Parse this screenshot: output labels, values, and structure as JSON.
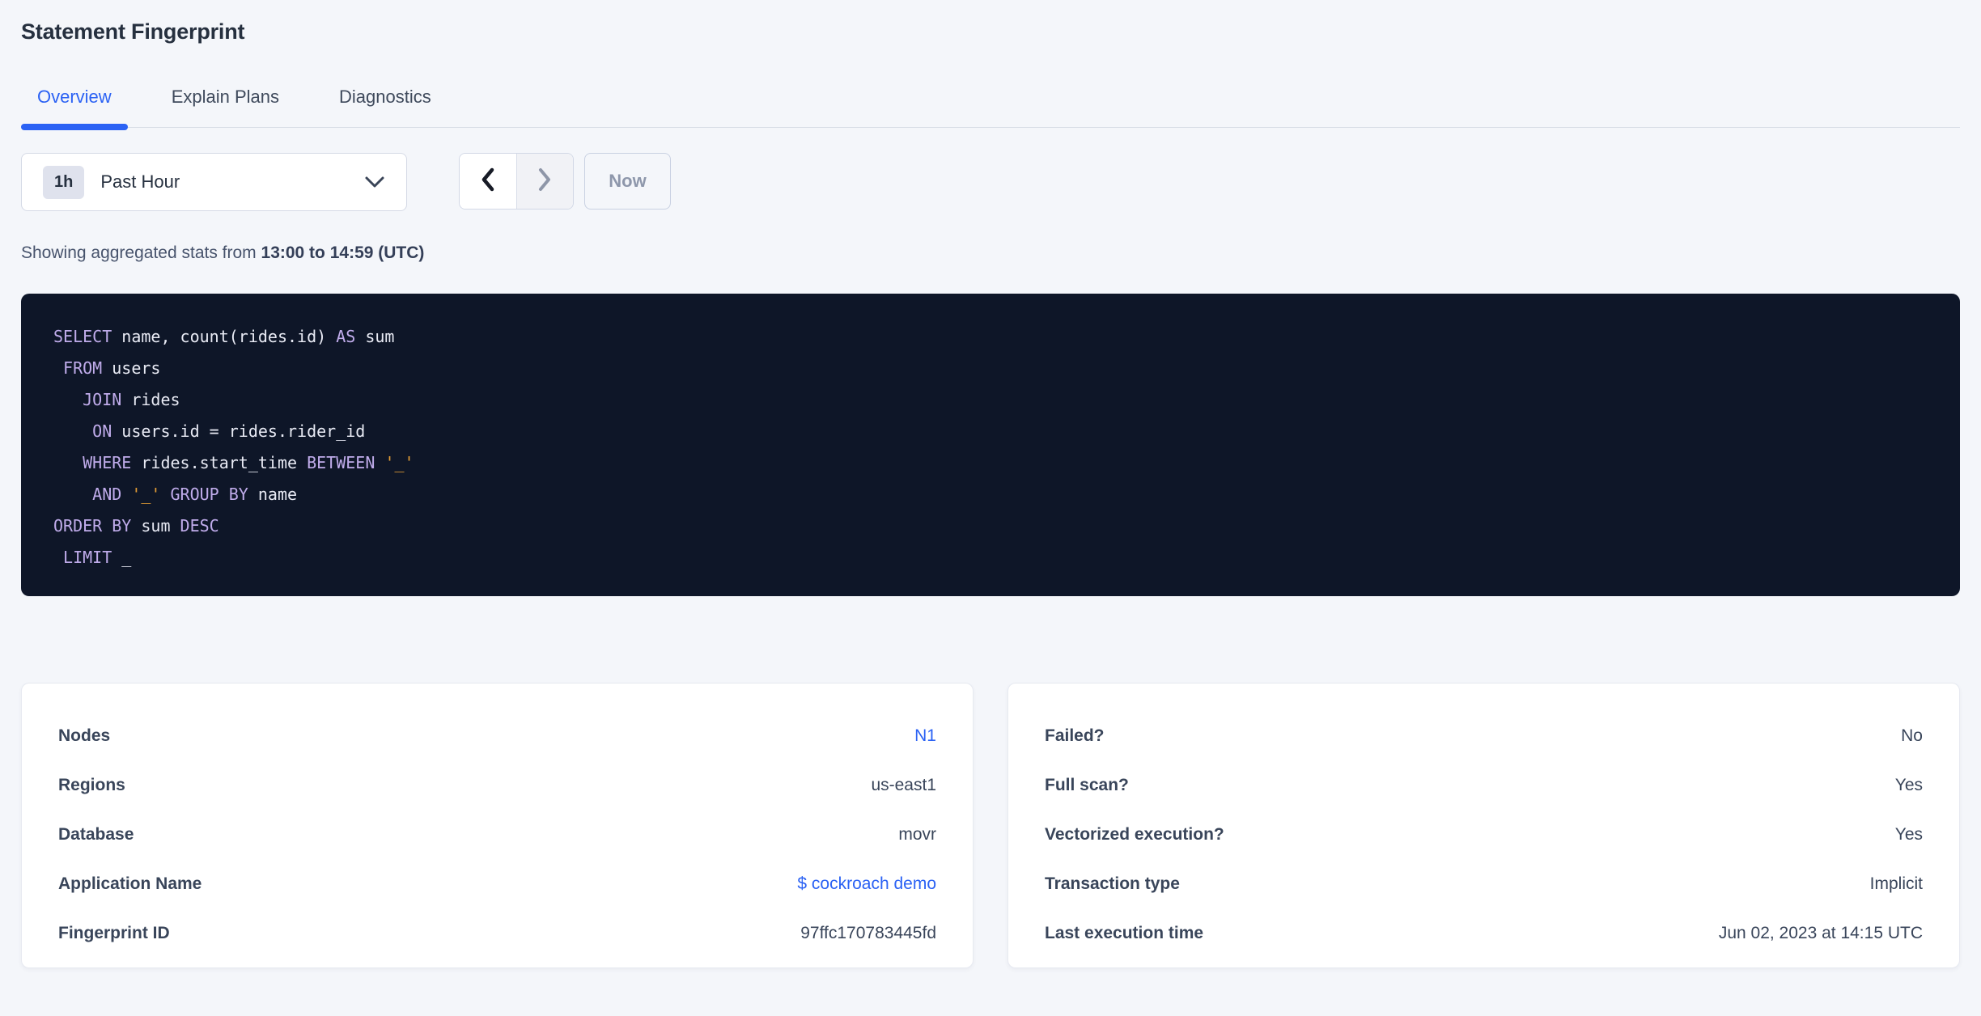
{
  "page": {
    "title": "Statement Fingerprint"
  },
  "tabs": [
    {
      "label": "Overview",
      "active": true
    },
    {
      "label": "Explain Plans",
      "active": false
    },
    {
      "label": "Diagnostics",
      "active": false
    }
  ],
  "time_picker": {
    "badge": "1h",
    "selected_label": "Past Hour",
    "now_label": "Now",
    "icons": {
      "open": "chevron-down-icon",
      "prev": "chevron-left-icon",
      "next": "chevron-right-icon"
    }
  },
  "stats_line": {
    "prefix": "Showing aggregated stats from ",
    "range_bold": "13:00 to 14:59 (UTC)"
  },
  "sql": {
    "lines": [
      [
        {
          "c": "kw",
          "t": "SELECT"
        },
        {
          "t": " name, count(rides.id) "
        },
        {
          "c": "kw",
          "t": "AS"
        },
        {
          "t": " sum"
        }
      ],
      [
        {
          "t": " "
        },
        {
          "c": "kw",
          "t": "FROM"
        },
        {
          "t": " users"
        }
      ],
      [
        {
          "t": "   "
        },
        {
          "c": "kw",
          "t": "JOIN"
        },
        {
          "t": " rides"
        }
      ],
      [
        {
          "t": "    "
        },
        {
          "c": "kw",
          "t": "ON"
        },
        {
          "t": " users.id = rides.rider_id"
        }
      ],
      [
        {
          "t": "   "
        },
        {
          "c": "kw",
          "t": "WHERE"
        },
        {
          "t": " rides.start_time "
        },
        {
          "c": "kw",
          "t": "BETWEEN"
        },
        {
          "t": " "
        },
        {
          "c": "lit",
          "t": "'_'"
        }
      ],
      [
        {
          "t": "    "
        },
        {
          "c": "kw",
          "t": "AND"
        },
        {
          "t": " "
        },
        {
          "c": "lit",
          "t": "'_'"
        },
        {
          "t": " "
        },
        {
          "c": "kw",
          "t": "GROUP BY"
        },
        {
          "t": " name"
        }
      ],
      [
        {
          "c": "kw",
          "t": "ORDER BY"
        },
        {
          "t": " sum "
        },
        {
          "c": "kw",
          "t": "DESC"
        }
      ],
      [
        {
          "t": " "
        },
        {
          "c": "kw",
          "t": "LIMIT"
        },
        {
          "t": " _"
        }
      ]
    ]
  },
  "cards": {
    "left": {
      "rows": [
        {
          "label": "Nodes",
          "value": "N1",
          "link": true
        },
        {
          "label": "Regions",
          "value": "us-east1",
          "link": false
        },
        {
          "label": "Database",
          "value": "movr",
          "link": false
        },
        {
          "label": "Application Name",
          "value": "$ cockroach demo",
          "link": true
        },
        {
          "label": "Fingerprint ID",
          "value": "97ffc170783445fd",
          "link": false
        }
      ]
    },
    "right": {
      "rows": [
        {
          "label": "Failed?",
          "value": "No",
          "link": false
        },
        {
          "label": "Full scan?",
          "value": "Yes",
          "link": false
        },
        {
          "label": "Vectorized execution?",
          "value": "Yes",
          "link": false
        },
        {
          "label": "Transaction type",
          "value": "Implicit",
          "link": false
        },
        {
          "label": "Last execution time",
          "value": "Jun 02, 2023 at 14:15 UTC",
          "link": false
        }
      ]
    }
  },
  "colors": {
    "accent_blue": "#2b62f4",
    "sql_background": "#0e1628",
    "sql_keyword": "#c0aceb",
    "sql_identifier": "#e9ebf5",
    "sql_literal": "#e39c35"
  }
}
